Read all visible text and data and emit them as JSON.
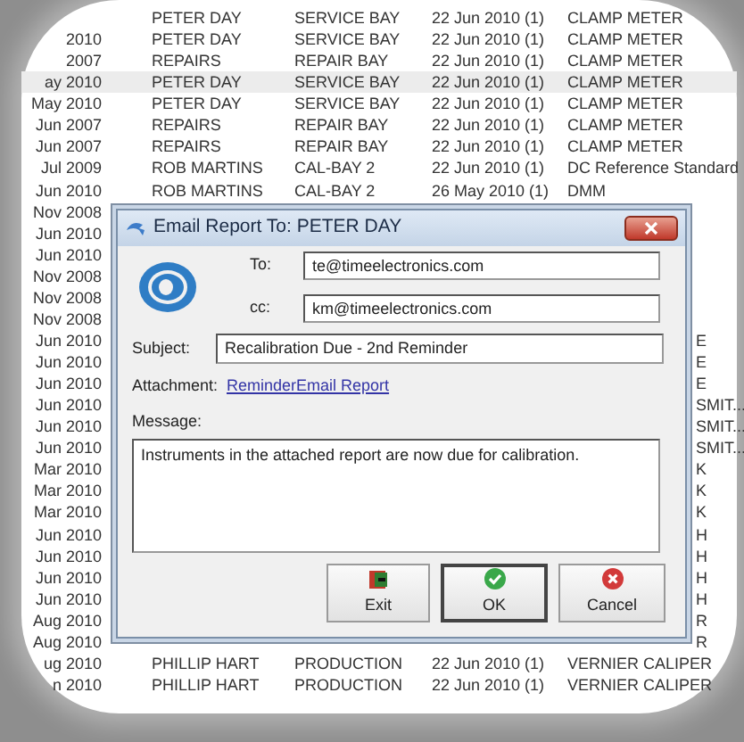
{
  "table": {
    "rows": [
      {
        "kind": "full",
        "column_2": "PETER DAY",
        "column_3": "SERVICE BAY",
        "column_4": "22 Jun 2010 (1)",
        "column_5": "CLAMP METER",
        "selected": false
      },
      {
        "kind": "full",
        "column_1": "2010",
        "column_2": "PETER DAY",
        "column_3": "SERVICE BAY",
        "column_4": "22 Jun 2010 (1)",
        "column_5": "CLAMP METER",
        "selected": false
      },
      {
        "kind": "full",
        "column_1": "2007",
        "column_2": "REPAIRS",
        "column_3": "REPAIR BAY",
        "column_4": "22 Jun 2010 (1)",
        "column_5": "CLAMP METER",
        "selected": false
      },
      {
        "kind": "full",
        "column_1": "ay 2010",
        "column_2": "PETER DAY",
        "column_3": "SERVICE BAY",
        "column_4": "22 Jun 2010 (1)",
        "column_5": "CLAMP METER",
        "selected": true
      },
      {
        "kind": "full",
        "column_1": "May 2010",
        "column_2": "PETER DAY",
        "column_3": "SERVICE BAY",
        "column_4": "22 Jun 2010 (1)",
        "column_5": "CLAMP METER",
        "selected": false
      },
      {
        "kind": "full",
        "column_1": "Jun 2007",
        "column_2": "REPAIRS",
        "column_3": "REPAIR BAY",
        "column_4": "22 Jun 2010 (1)",
        "column_5": "CLAMP METER",
        "selected": false
      },
      {
        "kind": "full",
        "column_1": "Jun 2007",
        "column_2": "REPAIRS",
        "column_3": "REPAIR BAY",
        "column_4": "22 Jun 2010 (1)",
        "column_5": "CLAMP METER",
        "selected": false
      },
      {
        "kind": "full",
        "column_1": "Jul 2009",
        "column_2": "ROB MARTINS",
        "column_3": "CAL-BAY 2",
        "column_4": "22 Jun 2010 (1)",
        "column_5": "DC Reference Standard",
        "selected": false
      },
      {
        "kind": "full",
        "column_1": "Jun 2010",
        "column_2": "ROB MARTINS",
        "column_3": "CAL-BAY 2",
        "column_4": "26 May 2010 (1)",
        "column_5": "DMM",
        "selected": false
      },
      {
        "kind": "covered",
        "column_1": "Nov 2008",
        "selected": false
      },
      {
        "kind": "covered",
        "column_1": "Jun 2010",
        "selected": false
      },
      {
        "kind": "covered",
        "column_1": "Jun 2010",
        "selected": false
      },
      {
        "kind": "covered",
        "column_1": "Nov 2008",
        "selected": false
      },
      {
        "kind": "covered",
        "column_1": "Nov 2008",
        "selected": false
      },
      {
        "kind": "covered",
        "column_1": "Nov 2008",
        "selected": false
      },
      {
        "kind": "covered",
        "column_1": "Jun 2010",
        "column_5": "E",
        "selected": false
      },
      {
        "kind": "covered",
        "column_1": "Jun 2010",
        "column_5": "E",
        "selected": false
      },
      {
        "kind": "covered",
        "column_1": "Jun 2010",
        "column_5": "E",
        "selected": false
      },
      {
        "kind": "covered",
        "column_1": "Jun 2010",
        "column_5": "SMIT...",
        "selected": false
      },
      {
        "kind": "covered",
        "column_1": "Jun 2010",
        "column_5": "SMIT...",
        "selected": false
      },
      {
        "kind": "covered",
        "column_1": "Jun 2010",
        "column_5": "SMIT...",
        "selected": false
      },
      {
        "kind": "covered",
        "column_1": "Mar 2010",
        "column_5": "K",
        "selected": false
      },
      {
        "kind": "covered",
        "column_1": "Mar 2010",
        "column_5": "K",
        "selected": false
      },
      {
        "kind": "covered",
        "column_1": "Mar 2010",
        "column_5": "K",
        "selected": false
      },
      {
        "kind": "covered",
        "column_1": "Jun 2010",
        "column_5": "H",
        "selected": false
      },
      {
        "kind": "covered",
        "column_1": "Jun 2010",
        "column_5": "H",
        "selected": false
      },
      {
        "kind": "covered",
        "column_1": "Jun 2010",
        "column_5": "H",
        "selected": false
      },
      {
        "kind": "covered",
        "column_1": "Jun 2010",
        "column_5": "H",
        "selected": false
      },
      {
        "kind": "covered",
        "column_1": "Aug 2010",
        "column_5": "R",
        "selected": false
      },
      {
        "kind": "covered",
        "column_1": "Aug 2010",
        "column_5": "R",
        "selected": false
      },
      {
        "kind": "full",
        "column_1": "ug 2010",
        "column_2": "PHILLIP HART",
        "column_3": "PRODUCTION",
        "column_4": "22 Jun 2010 (1)",
        "column_5": "VERNIER CALIPER",
        "selected": false
      },
      {
        "kind": "full",
        "column_1": "n 2010",
        "column_2": "PHILLIP HART",
        "column_3": "PRODUCTION",
        "column_4": "22 Jun 2010 (1)",
        "column_5": "VERNIER CALIPER",
        "selected": false
      }
    ]
  },
  "dialog": {
    "title": "Email Report To: PETER DAY",
    "to_label": "To:",
    "to": "te@timeelectronics.com",
    "cc_label": "cc:",
    "cc": "km@timeelectronics.com",
    "subject_label": "Subject:",
    "subject": "Recalibration Due - 2nd Reminder",
    "attachment_label": "Attachment:",
    "attachment": "ReminderEmail Report",
    "message_label": "Message:",
    "message": "Instruments in the attached report are now due for calibration.",
    "buttons": [
      {
        "kind": "exit",
        "label": "Exit",
        "default": false
      },
      {
        "kind": "ok",
        "label": "OK",
        "default": true
      },
      {
        "kind": "cancel",
        "label": "Cancel",
        "default": false
      }
    ]
  }
}
